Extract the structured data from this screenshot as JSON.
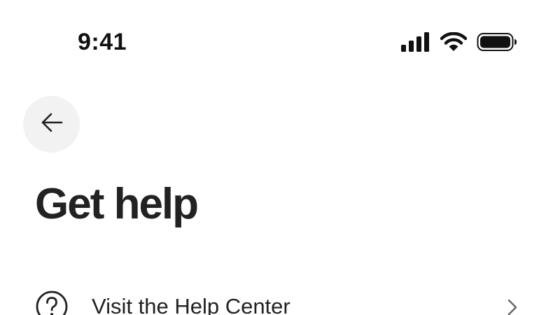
{
  "status_bar": {
    "time": "9:41",
    "icons": [
      "signal-icon",
      "wifi-icon",
      "battery-icon"
    ]
  },
  "header": {
    "back_icon": "arrow-left-icon"
  },
  "page": {
    "title": "Get help"
  },
  "help_items": [
    {
      "icon": "question-circle-icon",
      "label": "Visit the Help Center",
      "trailing_icon": "chevron-right-icon"
    }
  ],
  "colors": {
    "text_primary": "#222222",
    "back_button_bg": "#f2f2f2",
    "chevron": "#6a6a6a",
    "background": "#ffffff"
  }
}
